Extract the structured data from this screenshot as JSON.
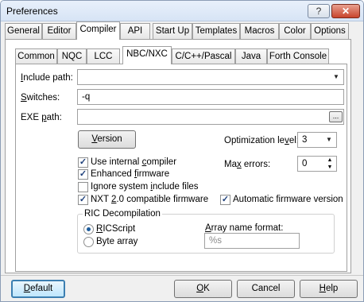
{
  "window": {
    "title": "Preferences",
    "help_glyph": "?",
    "close_glyph": "✕"
  },
  "tabs": [
    {
      "label": "General"
    },
    {
      "label": "Editor"
    },
    {
      "label": "Compiler",
      "selected": true
    },
    {
      "label": "API"
    },
    {
      "label": "Start Up"
    },
    {
      "label": "Templates"
    },
    {
      "label": "Macros"
    },
    {
      "label": "Color"
    },
    {
      "label": "Options"
    }
  ],
  "subtabs": [
    {
      "label": "Common"
    },
    {
      "label": "NQC"
    },
    {
      "label": "LCC"
    },
    {
      "label": "NBC/NXC",
      "selected": true
    },
    {
      "label": "C/C++/Pascal"
    },
    {
      "label": "Java"
    },
    {
      "label": "Forth Console"
    }
  ],
  "form": {
    "include_path_label_pre": "I",
    "include_path_label_post": "nclude path:",
    "include_path_value": "",
    "switches_label_pre": "S",
    "switches_label_post": "witches:",
    "switches_value": "-q",
    "exe_path_label_pre": "EXE ",
    "exe_path_label_ul": "p",
    "exe_path_label_post": "ath:",
    "exe_path_value": "",
    "browse_label": "...",
    "version_pre": "",
    "version_ul": "V",
    "version_post": "ersion",
    "opt_level_label_pre": "Optimization le",
    "opt_level_label_ul": "v",
    "opt_level_label_post": "el:",
    "opt_level_value": "3",
    "max_errors_label_pre": "Ma",
    "max_errors_label_ul": "x",
    "max_errors_label_post": " errors:",
    "max_errors_value": "0"
  },
  "checkboxes": [
    {
      "pre": "Use internal ",
      "ul": "c",
      "post": "ompiler",
      "checked": true
    },
    {
      "pre": "Enhanced ",
      "ul": "f",
      "post": "irmware",
      "checked": true
    },
    {
      "pre": "Ignore system ",
      "ul": "i",
      "post": "nclude files",
      "checked": false
    },
    {
      "pre": "NXT ",
      "ul": "2",
      "post": ".0 compatible firmware",
      "checked": true
    },
    {
      "pre": "Automatic firmware version",
      "ul": "",
      "post": "",
      "checked": true
    }
  ],
  "ric": {
    "group_title": "RIC Decompilation",
    "option_ricscript_pre": "",
    "option_ricscript_ul": "R",
    "option_ricscript_post": "ICScript",
    "option_ricscript_selected": true,
    "option_bytearray": "Byte array",
    "option_bytearray_selected": false,
    "array_name_label_pre": "",
    "array_name_label_ul": "A",
    "array_name_label_post": "rray name format:",
    "array_name_value": "%s"
  },
  "footer": {
    "default_pre": "",
    "default_ul": "D",
    "default_post": "efault",
    "ok_pre": "",
    "ok_ul": "O",
    "ok_post": "K",
    "cancel": "Cancel",
    "help_pre": "",
    "help_ul": "H",
    "help_post": "elp"
  },
  "icons": {
    "dropdown": "▼",
    "check": "✓",
    "spin_up": "▲",
    "spin_down": "▼"
  }
}
